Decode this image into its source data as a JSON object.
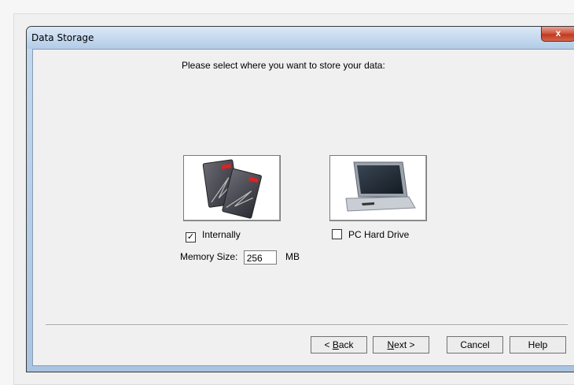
{
  "window": {
    "title": "Data Storage",
    "close_symbol": "x"
  },
  "prompt": "Please select where you want to store your data:",
  "options": [
    {
      "label": "Internally",
      "checked": true,
      "icon": "memory-cards-image"
    },
    {
      "label": "PC Hard Drive",
      "checked": false,
      "icon": "laptop-image"
    }
  ],
  "memory": {
    "label": "Memory Size:",
    "value": "256",
    "unit": "MB"
  },
  "buttons": {
    "back_pre": "< ",
    "back_u": "B",
    "back_rest": "ack",
    "next_u": "N",
    "next_rest": "ext >",
    "cancel": "Cancel",
    "help": "Help"
  },
  "colors": {
    "titlebar": "#c2d7ee",
    "close": "#c0391f",
    "client": "#f0f0f0"
  }
}
